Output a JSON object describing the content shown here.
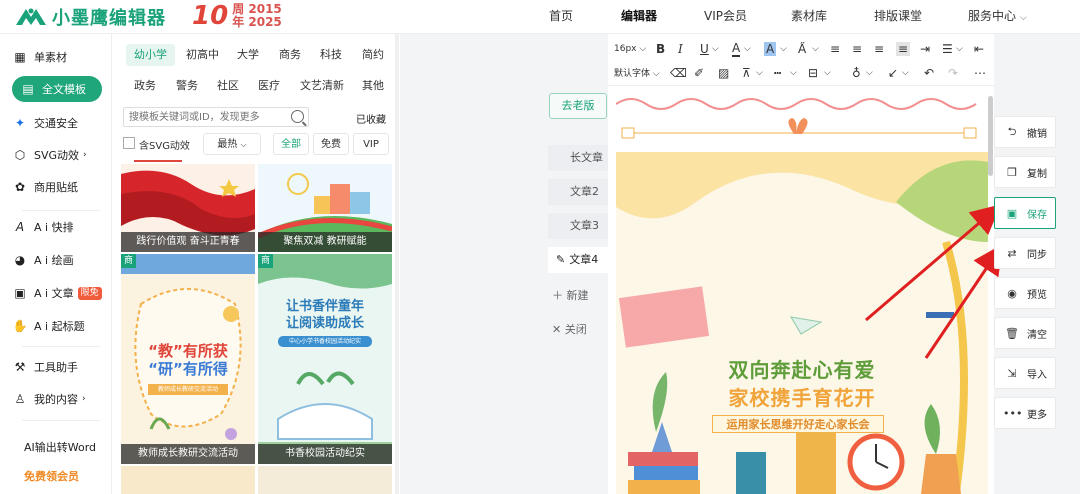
{
  "header": {
    "logo_text": "小墨鹰编辑器",
    "anniv_number": "10",
    "anniv_line1": "周 2015",
    "anniv_line2": "年 2025",
    "nav": [
      {
        "label": "首页"
      },
      {
        "label": "编辑器"
      },
      {
        "label": "VIP会员"
      },
      {
        "label": "素材库"
      },
      {
        "label": "排版课堂"
      },
      {
        "label": "服务中心"
      }
    ]
  },
  "sidebar": {
    "items": [
      {
        "label": "单素材",
        "icon": "grid-icon"
      },
      {
        "label": "全文模板",
        "icon": "document-icon"
      },
      {
        "label": "交通安全",
        "icon": "traffic-icon"
      },
      {
        "label": "SVG动效",
        "icon": "svg-icon"
      },
      {
        "label": "商用贴纸",
        "icon": "sticker-icon"
      },
      {
        "label": "A i 快排",
        "icon": "ai-layout-icon"
      },
      {
        "label": "A i 绘画",
        "icon": "palette-icon"
      },
      {
        "label": "A i 文章",
        "icon": "ai-article-icon",
        "badge": "限免"
      },
      {
        "label": "A i 起标题",
        "icon": "ai-title-icon"
      },
      {
        "label": "工具助手",
        "icon": "tools-icon"
      },
      {
        "label": "我的内容",
        "icon": "user-icon"
      }
    ],
    "ai_word": "AI输出转Word",
    "free_vip": "免费领会员"
  },
  "templates": {
    "categories_row1": [
      "幼小学",
      "初高中",
      "大学",
      "商务",
      "科技",
      "简约"
    ],
    "categories_row2": [
      "政务",
      "警务",
      "社区",
      "医疗",
      "文艺清新",
      "其他"
    ],
    "search_placeholder": "搜模板关键词或ID，发现更多",
    "collected": "已收藏",
    "svg_checkbox": "含SVG动效",
    "sort": "最热",
    "filters": [
      "全部",
      "免费",
      "VIP"
    ],
    "cards": [
      {
        "caption": "践行价值观 奋斗正青春"
      },
      {
        "caption": "聚焦双减 教研赋能"
      },
      {
        "caption": "教师成长教研交流活动",
        "tag": "商",
        "title1": "“教”有所获",
        "title2": "“研”有所得",
        "sub": "教师成长教研交流活动"
      },
      {
        "caption": "书香校园活动纪实",
        "tag": "商",
        "title1": "让书香伴童年",
        "title2": "让阅读助成长",
        "sub": "中心小学书香校园活动纪实"
      }
    ]
  },
  "old_version": "去老版",
  "pages": {
    "items": [
      "长文章",
      "文章2",
      "文章3",
      "文章4"
    ],
    "add": "新建",
    "close": "关闭"
  },
  "editor": {
    "font_size": "16px",
    "font_family": "默认字体",
    "poster_title1": "双向奔赴心有爱",
    "poster_title2": "家校携手育花开",
    "poster_sub": "运用家长思维开好走心家长会"
  },
  "actions": [
    {
      "label": "撤销",
      "icon": "undo-icon"
    },
    {
      "label": "复制",
      "icon": "copy-icon"
    },
    {
      "label": "保存",
      "icon": "save-icon"
    },
    {
      "label": "同步",
      "icon": "sync-icon"
    },
    {
      "label": "预览",
      "icon": "eye-icon"
    },
    {
      "label": "清空",
      "icon": "trash-icon"
    },
    {
      "label": "导入",
      "icon": "import-icon"
    },
    {
      "label": "更多",
      "icon": "more-icon"
    }
  ],
  "colors": {
    "brand": "#1aa37a",
    "accent_red": "#e0453a",
    "arrow": "#e02020"
  }
}
